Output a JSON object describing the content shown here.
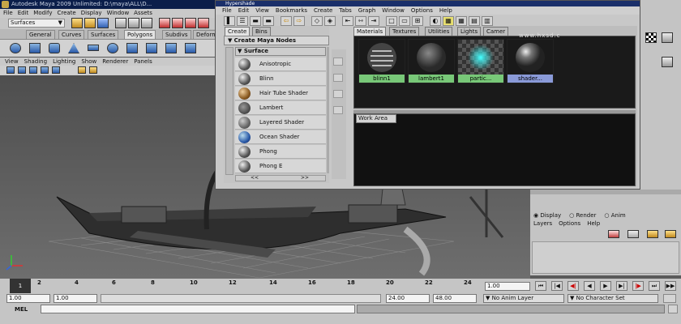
{
  "maya": {
    "title": "Autodesk Maya 2009 Unlimited: D:\\maya\\ALL\\D...",
    "menu": [
      "File",
      "Edit",
      "Modify",
      "Create",
      "Display",
      "Window",
      "Assets"
    ],
    "mode_select": "Surfaces",
    "shelf_tabs": [
      "General",
      "Curves",
      "Surfaces",
      "Polygons",
      "Subdivs",
      "Deform"
    ],
    "active_shelf_tab": "Polygons",
    "viewport_menu": [
      "View",
      "Shading",
      "Lighting",
      "Show",
      "Renderer",
      "Panels"
    ]
  },
  "hypershade": {
    "title": "Hypershade",
    "menu": [
      "File",
      "Edit",
      "View",
      "Bookmarks",
      "Create",
      "Tabs",
      "Graph",
      "Window",
      "Options",
      "Help"
    ],
    "left_tabs": [
      "Create",
      "Bins"
    ],
    "create_header": "Create Maya Nodes",
    "nodes": [
      "Anisotropic",
      "Blinn",
      "Hair Tube Shader",
      "Lambert",
      "Layered Shader",
      "Ocean Shader",
      "Phong",
      "Phong E"
    ],
    "section": "Surface",
    "scroll_left": "<<",
    "scroll_right": ">>",
    "scene_tabs": [
      "Materials",
      "Textures",
      "Utilities",
      "Lights",
      "Camer"
    ],
    "materials": [
      {
        "name": "blinn1",
        "color": "#3a3a3a"
      },
      {
        "name": "lambert1",
        "color": "#555555"
      },
      {
        "name": "partic...",
        "color": "#2a9aa0"
      },
      {
        "name": "shader...",
        "color": "#777777"
      }
    ],
    "work_area": "Work Area"
  },
  "channel_box": {
    "radios": [
      "Display",
      "Render",
      "Anim"
    ],
    "menu": [
      "Layers",
      "Options",
      "Help"
    ]
  },
  "timeline": {
    "ticks": [
      "2",
      "4",
      "6",
      "8",
      "10",
      "12",
      "14",
      "16",
      "18",
      "20",
      "22",
      "24"
    ],
    "current_frame": "1.00"
  },
  "range": {
    "start": "1.00",
    "start2": "1.00",
    "end": "24.00",
    "end2": "48.00",
    "anim_layer": "No Anim Layer",
    "character_set": "No Character Set"
  },
  "command": {
    "label": "MEL"
  },
  "watermark": "www.hxsd.c"
}
